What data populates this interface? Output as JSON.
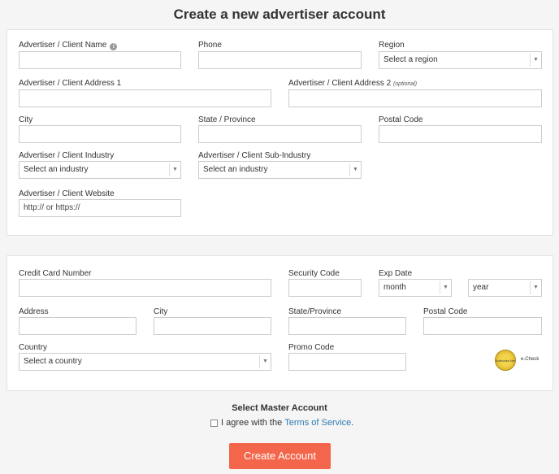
{
  "page": {
    "title": "Create a new advertiser account"
  },
  "advertiser": {
    "name_label": "Advertiser / Client Name",
    "phone_label": "Phone",
    "region_label": "Region",
    "region_value": "Select a region",
    "address1_label": "Advertiser / Client Address 1",
    "address2_label": "Advertiser / Client Address 2",
    "address2_optional": "(optional)",
    "city_label": "City",
    "state_label": "State / Province",
    "postal_label": "Postal Code",
    "industry_label": "Advertiser / Client Industry",
    "industry_value": "Select an industry",
    "subindustry_label": "Advertiser / Client Sub-Industry",
    "subindustry_value": "Select an industry",
    "website_label": "Advertiser / Client Website",
    "website_placeholder": "http:// or https://"
  },
  "billing": {
    "cc_label": "Credit Card Number",
    "security_label": "Security Code",
    "exp_label": "Exp Date",
    "month_value": "month",
    "year_value": "year",
    "address_label": "Address",
    "city_label": "City",
    "state_label": "State/Province",
    "postal_label": "Postal Code",
    "country_label": "Country",
    "country_value": "Select a country",
    "promo_label": "Promo Code",
    "badge_text": "Authorize.Net",
    "echeck_text": "e-Check"
  },
  "footer": {
    "master_account": "Select Master Account",
    "agree_prefix": "I agree with the",
    "terms_link": "Terms of Service",
    "agree_suffix": ".",
    "create_button": "Create Account"
  },
  "colors": {
    "accent": "#f4664b",
    "link": "#2a7ab0"
  }
}
